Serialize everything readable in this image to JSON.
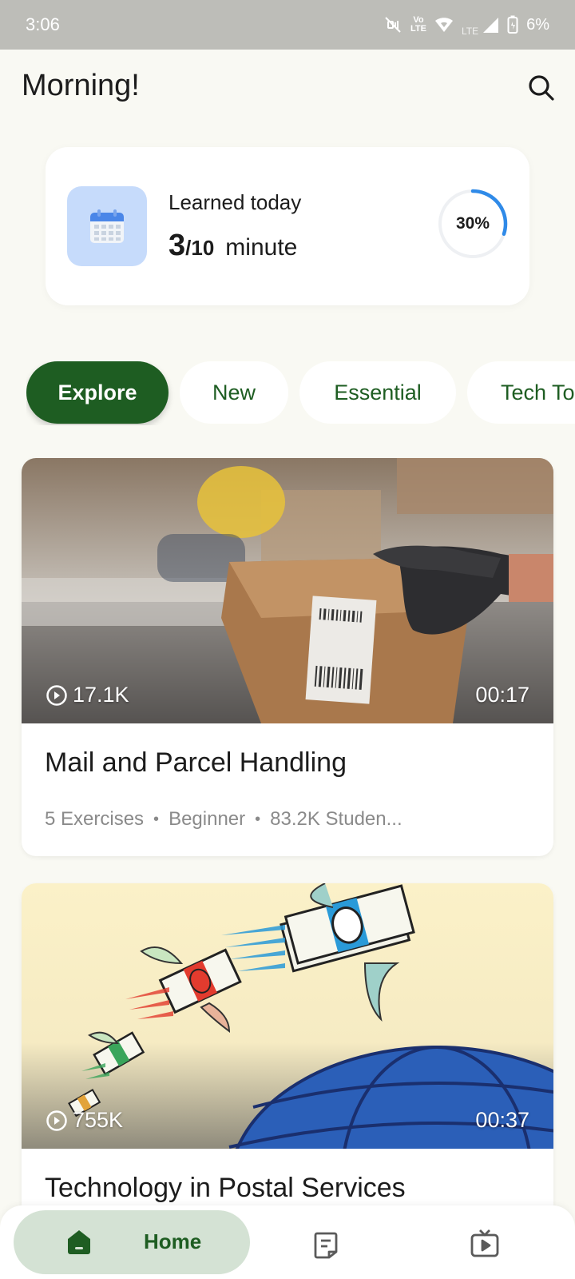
{
  "status_bar": {
    "time": "3:06",
    "volte_top": "Vo",
    "volte_bottom": "LTE",
    "lte": "LTE",
    "battery": "6%"
  },
  "header": {
    "greeting": "Morning!",
    "search_icon": "search-icon"
  },
  "progress": {
    "label": "Learned today",
    "done": "3",
    "goal": "/10",
    "unit": "minute",
    "percent_label": "30%",
    "percent_value": 0.3,
    "ring_color": "#2f8ae8",
    "calendar_icon": "calendar-icon"
  },
  "chips": [
    {
      "label": "Explore",
      "active": true
    },
    {
      "label": "New",
      "active": false
    },
    {
      "label": "Essential",
      "active": false
    },
    {
      "label": "Tech To",
      "active": false
    }
  ],
  "courses": [
    {
      "title": "Mail and Parcel Handling",
      "views": "17.1K",
      "duration": "00:17",
      "exercises": "5 Exercises",
      "level": "Beginner",
      "students": "83.2K Studen..."
    },
    {
      "title": "Technology in Postal Services",
      "views": "755K",
      "duration": "00:37"
    }
  ],
  "nav": {
    "home_label": "Home",
    "home_icon": "home-icon",
    "notes_icon": "notes-icon",
    "video_icon": "video-icon"
  },
  "colors": {
    "brand_green": "#1e5d22",
    "background": "#f9f9f3",
    "home_pill": "#d4e2d4"
  }
}
